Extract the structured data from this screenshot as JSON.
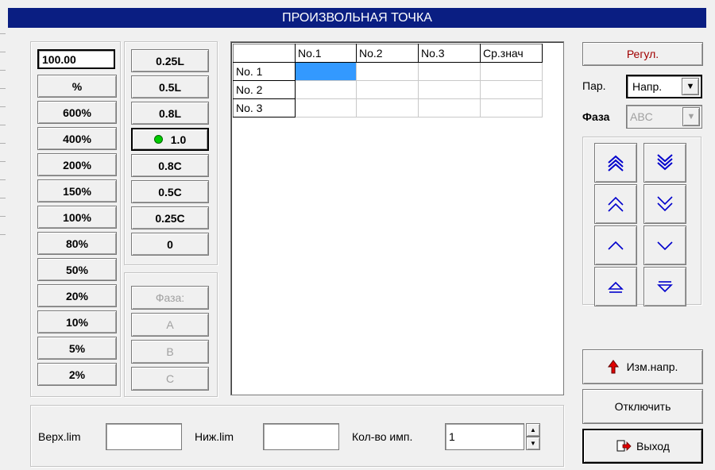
{
  "window": {
    "title": "ПРОИЗВОЛЬНАЯ ТОЧКА"
  },
  "percent_panel": {
    "value": "100.00",
    "buttons": [
      "%",
      "600%",
      "400%",
      "200%",
      "150%",
      "100%",
      "80%",
      "50%",
      "20%",
      "10%",
      "5%",
      "2%"
    ]
  },
  "pf_panel": {
    "buttons": [
      "0.25L",
      "0.5L",
      "0.8L",
      "1.0",
      "0.8C",
      "0.5C",
      "0.25C",
      "0"
    ],
    "active": "1.0",
    "active_color": "#00cc00"
  },
  "phase_panel": {
    "buttons": [
      "Фаза:",
      "A",
      "B",
      "C"
    ]
  },
  "table": {
    "columns": [
      "",
      "No.1",
      "No.2",
      "No.3",
      "Ср.знач"
    ],
    "rows": [
      {
        "label": "No. 1",
        "cells": [
          "",
          "",
          "",
          ""
        ]
      },
      {
        "label": "No. 2",
        "cells": [
          "",
          "",
          "",
          ""
        ]
      },
      {
        "label": "No. 3",
        "cells": [
          "",
          "",
          "",
          ""
        ]
      }
    ],
    "selected_color": "#3399ff"
  },
  "bottom": {
    "upper_label": "Верх.lim",
    "upper_value": "",
    "lower_label": "Ниж.lim",
    "lower_value": "",
    "pulses_label": "Кол-во имп.",
    "pulses_value": "1"
  },
  "right_panel": {
    "regul_label": "Регул.",
    "regul_color": "#a00000",
    "param_label": "Пар.",
    "param_value": "Напр.",
    "phase_label": "Фаза",
    "phase_value": "ABC",
    "change_dir_label": "Изм.напр.",
    "disconnect_label": "Отключить",
    "exit_label": "Выход",
    "arrow_color": "#0000cc",
    "arrows": [
      "triple-up-icon",
      "triple-down-icon",
      "double-up-icon",
      "double-down-icon",
      "single-up-icon",
      "single-down-icon",
      "triangle-up-icon",
      "triangle-down-icon"
    ]
  }
}
